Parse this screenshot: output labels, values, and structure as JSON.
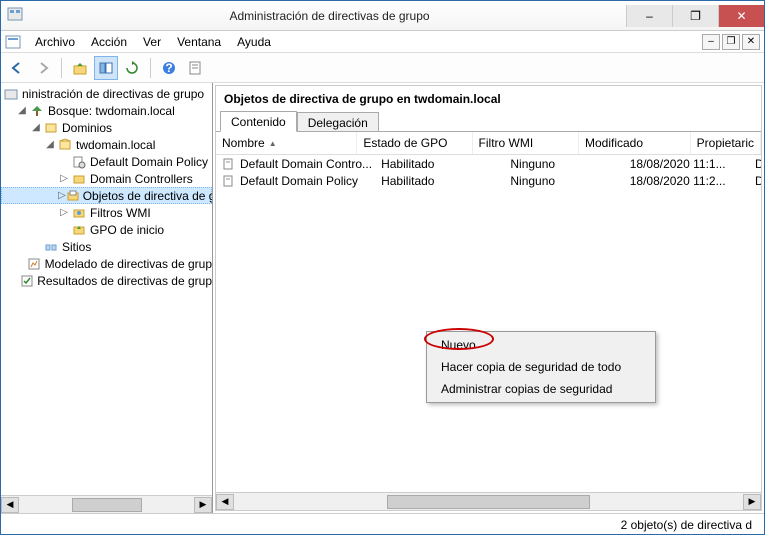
{
  "title": "Administración de directivas de grupo",
  "window_buttons": {
    "minimize": "–",
    "maximize": "❐",
    "close": "✕"
  },
  "mdi_buttons": {
    "minimize": "–",
    "restore": "❐",
    "close": "✕"
  },
  "menu": [
    "Archivo",
    "Acción",
    "Ver",
    "Ventana",
    "Ayuda"
  ],
  "tree": {
    "root": "ninistración de directivas de grupo",
    "forest": "Bosque: twdomain.local",
    "domains": "Dominios",
    "domain": "twdomain.local",
    "items": [
      "Default Domain Policy",
      "Domain Controllers",
      "Objetos de directiva de g",
      "Filtros WMI",
      "GPO de inicio"
    ],
    "sites": "Sitios",
    "modeling": "Modelado de directivas de grup",
    "results": "Resultados de directivas de grup"
  },
  "detail": {
    "heading": "Objetos de directiva de grupo en twdomain.local",
    "tabs": [
      "Contenido",
      "Delegación"
    ],
    "columns": [
      "Nombre",
      "Estado de GPO",
      "Filtro WMI",
      "Modificado",
      "Propietaric"
    ],
    "sort_indicator": "▲",
    "rows": [
      {
        "nombre": "Default Domain Contro...",
        "estado": "Habilitado",
        "filtro": "Ninguno",
        "mod": "18/08/2020 11:1...",
        "prop": "Domain Ac"
      },
      {
        "nombre": "Default Domain Policy",
        "estado": "Habilitado",
        "filtro": "Ninguno",
        "mod": "18/08/2020 11:2...",
        "prop": "Domain Ac"
      }
    ]
  },
  "context_menu": [
    "Nuevo",
    "Hacer copia de seguridad de todo",
    "Administrar copias de seguridad"
  ],
  "status": "2 objeto(s) de directiva d"
}
